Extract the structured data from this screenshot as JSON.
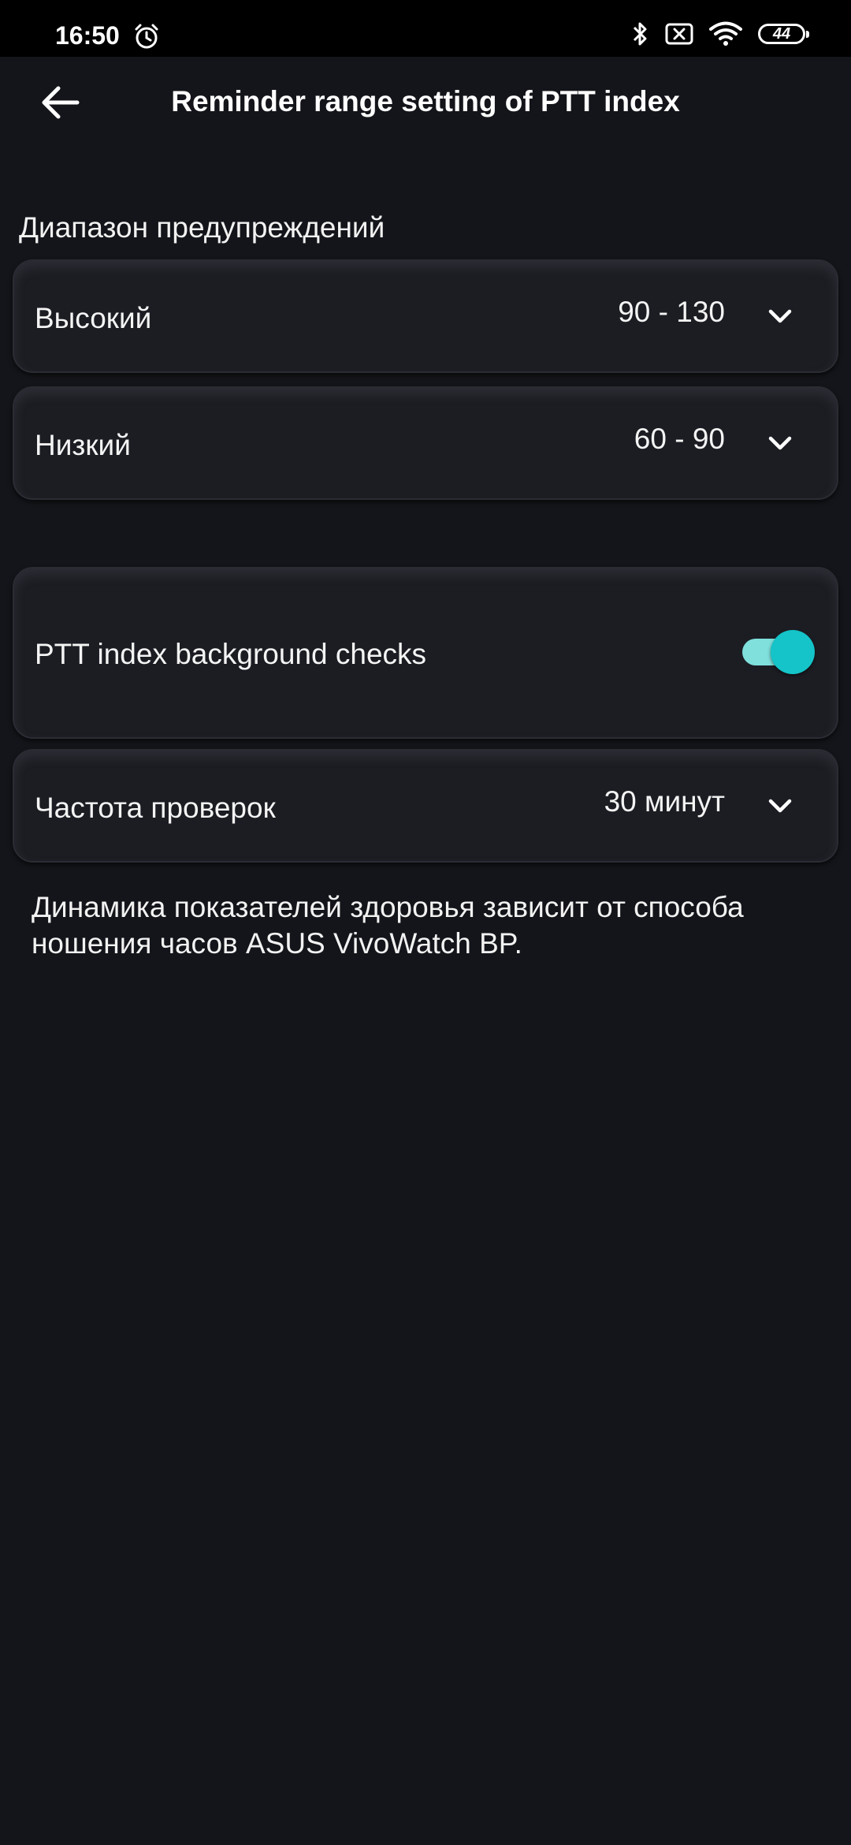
{
  "status_bar": {
    "time": "16:50",
    "battery": "44",
    "icons": [
      "alarm-icon",
      "bluetooth-icon",
      "sim-off-icon",
      "wifi-icon",
      "battery-icon"
    ]
  },
  "header": {
    "title": "Reminder range setting of PTT index",
    "back_icon": "arrow-left-icon"
  },
  "warning_range": {
    "label": "Диапазон предупреждений",
    "items": [
      {
        "label": "Высокий",
        "value": "90 - 130",
        "icon": "chevron-down-icon"
      },
      {
        "label": "Низкий",
        "value": "60 - 90",
        "icon": "chevron-down-icon"
      }
    ]
  },
  "background_checks": {
    "label": "PTT index background checks",
    "enabled": true,
    "accent_color": "#14c4c8"
  },
  "check_frequency": {
    "label": "Частота проверок",
    "value": "30 минут",
    "icon": "chevron-down-icon"
  },
  "footnote": "Динамика показателей здоровья зависит от способа ношения часов ASUS VivoWatch BP."
}
